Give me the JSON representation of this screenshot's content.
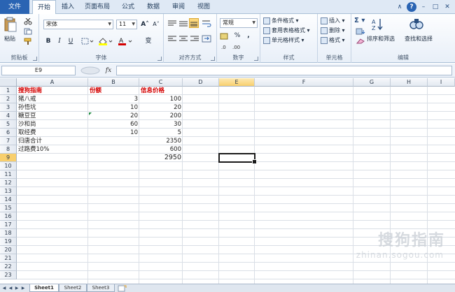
{
  "ribbon": {
    "tabs": [
      "文件",
      "开始",
      "插入",
      "页面布局",
      "公式",
      "数据",
      "审阅",
      "视图"
    ],
    "active_tab": "开始",
    "groups": {
      "clipboard": {
        "label": "剪贴板",
        "paste": "粘贴"
      },
      "font": {
        "label": "字体",
        "font_name": "宋体",
        "font_size": "11",
        "bold": "B",
        "italic": "I",
        "underline": "U",
        "grow": "A˄",
        "shrink": "A˅",
        "wen": "变"
      },
      "alignment": {
        "label": "对齐方式"
      },
      "number": {
        "label": "数字",
        "format": "常规",
        "percent": "%",
        "comma": ","
      },
      "styles": {
        "label": "样式",
        "conditional": "条件格式",
        "table": "套用表格格式",
        "cell_style": "单元格样式"
      },
      "cells": {
        "label": "单元格",
        "insert": "插入",
        "delete": "删除",
        "format": "格式"
      },
      "editing": {
        "label": "编辑",
        "sigma": "Σ",
        "sort": "排序和筛选",
        "find": "查找和选择"
      }
    }
  },
  "formula_bar": {
    "name_box": "E9",
    "fx": "fx",
    "value": ""
  },
  "grid": {
    "columns": [
      "A",
      "B",
      "C",
      "D",
      "E",
      "F",
      "G",
      "H",
      "I"
    ],
    "selected_column": "E",
    "rows": [
      "1",
      "2",
      "3",
      "4",
      "5",
      "6",
      "7",
      "8",
      "9",
      "10",
      "11",
      "12",
      "13",
      "14",
      "15",
      "16",
      "17",
      "18",
      "19",
      "20",
      "21",
      "22",
      "23"
    ],
    "selected_row": "9",
    "header": {
      "a": "搜狗指南",
      "b": "份额",
      "c": "信息价格"
    },
    "data": [
      {
        "a": "猪八戒",
        "b": "3",
        "c": "100"
      },
      {
        "a": "孙悟坑",
        "b": "10",
        "c": "20"
      },
      {
        "a": "糖豆豆",
        "b": "20",
        "c": "200"
      },
      {
        "a": "沙和尚",
        "b": "60",
        "c": "30"
      },
      {
        "a": "取经费",
        "b": "10",
        "c": "5"
      },
      {
        "a": "归唐合计",
        "b": "",
        "c": "2350"
      },
      {
        "a": "过路费10%",
        "b": "",
        "c": "600"
      }
    ],
    "total": "2950"
  },
  "sheets": {
    "tabs": [
      "Sheet1",
      "Sheet2",
      "Sheet3"
    ],
    "active": "Sheet1"
  },
  "watermark": {
    "brand": "搜狗指南",
    "url": "zhinan.sogou.com"
  },
  "colors": {
    "file_tab": "#2a64b3",
    "header_text": "#d40000",
    "selection_header": "#f8cf6d",
    "error_triangle": "#1c8a3e"
  }
}
